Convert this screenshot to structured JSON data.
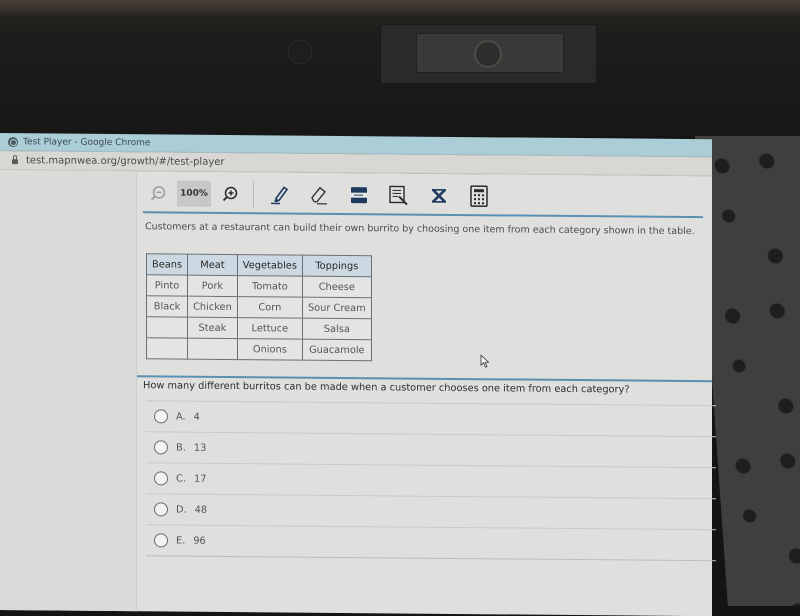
{
  "browser": {
    "window_title": "Test Player - Google Chrome",
    "url": "test.mapnwea.org/growth/#/test-player"
  },
  "toolbar": {
    "zoom_level": "100%",
    "tools": [
      {
        "name": "zoom-out",
        "icon": "zoom-out-icon"
      },
      {
        "name": "zoom-in",
        "icon": "zoom-in-icon"
      },
      {
        "name": "highlighter",
        "icon": "highlighter-icon"
      },
      {
        "name": "eraser",
        "icon": "eraser-icon"
      },
      {
        "name": "line-reader",
        "icon": "line-reader-icon"
      },
      {
        "name": "notepad",
        "icon": "notepad-icon"
      },
      {
        "name": "answer-eliminator",
        "icon": "answer-eliminator-icon"
      },
      {
        "name": "calculator",
        "icon": "calculator-icon"
      }
    ]
  },
  "passage": {
    "text": "Customers at a restaurant can build their own burrito by choosing one item from each category shown in the table."
  },
  "table": {
    "headers": [
      "Beans",
      "Meat",
      "Vegetables",
      "Toppings"
    ],
    "rows": [
      [
        "Pinto",
        "Pork",
        "Tomato",
        "Cheese"
      ],
      [
        "Black",
        "Chicken",
        "Corn",
        "Sour Cream"
      ],
      [
        "",
        "Steak",
        "Lettuce",
        "Salsa"
      ],
      [
        "",
        "",
        "Onions",
        "Guacamole"
      ]
    ]
  },
  "question": {
    "text": "How many different burritos can be made when a customer chooses one item from each category?"
  },
  "choices": [
    {
      "letter": "A.",
      "value": "4"
    },
    {
      "letter": "B.",
      "value": "13"
    },
    {
      "letter": "C.",
      "value": "17"
    },
    {
      "letter": "D.",
      "value": "48"
    },
    {
      "letter": "E.",
      "value": "96"
    }
  ],
  "colors": {
    "accent_line": "#5b8fb3",
    "titlebar": "#aacdd6",
    "table_header": "#ccd9e2",
    "tool_icon": "#1f3a5f"
  }
}
